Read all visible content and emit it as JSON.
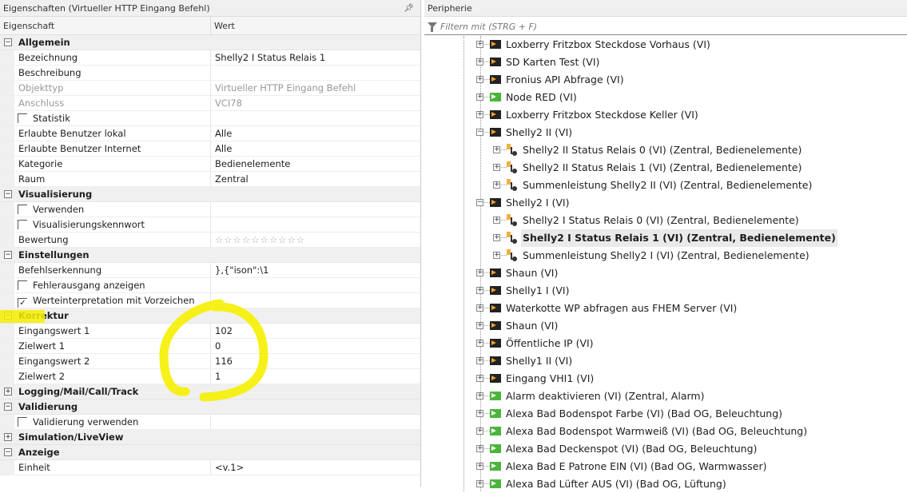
{
  "left_panel": {
    "title": "Eigenschaften (Virtueller HTTP Eingang Befehl)",
    "pin_icon": "pin-icon",
    "columns": [
      "Eigenschaft",
      "Wert"
    ],
    "rating_stars": 10,
    "sections": [
      {
        "label": "Allgemein",
        "expanded": true,
        "rows": [
          {
            "key": "Bezeichnung",
            "value": "Shelly2 I Status Relais 1"
          },
          {
            "key": "Beschreibung",
            "value": ""
          },
          {
            "key": "Objekttyp",
            "value": "Virtueller HTTP Eingang Befehl",
            "disabled": true
          },
          {
            "key": "Anschluss",
            "value": "VCI78",
            "disabled": true
          },
          {
            "key": "Statistik",
            "value": "",
            "checkbox": true,
            "checked": false
          },
          {
            "key": "Erlaubte Benutzer lokal",
            "value": "Alle"
          },
          {
            "key": "Erlaubte Benutzer Internet",
            "value": "Alle"
          },
          {
            "key": "Kategorie",
            "value": "Bedienelemente"
          },
          {
            "key": "Raum",
            "value": "Zentral"
          }
        ]
      },
      {
        "label": "Visualisierung",
        "expanded": true,
        "rows": [
          {
            "key": "Verwenden",
            "value": "",
            "checkbox": true,
            "checked": false
          },
          {
            "key": "Visualisierungskennwort",
            "value": "",
            "checkbox": true,
            "checked": false
          },
          {
            "key": "Bewertung",
            "value": "☆☆☆☆☆☆☆☆☆☆"
          }
        ]
      },
      {
        "label": "Einstellungen",
        "expanded": true,
        "rows": [
          {
            "key": "Befehlserkennung",
            "value": "},{\"ison\":\\1"
          },
          {
            "key": "Fehlerausgang anzeigen",
            "value": "",
            "checkbox": true,
            "checked": false
          },
          {
            "key": "Werteinterpretation mit Vorzeichen",
            "value": "",
            "checkbox": true,
            "checked": true
          }
        ]
      },
      {
        "label": "Korrektur",
        "expanded": true,
        "highlighted": true,
        "rows": [
          {
            "key": "Eingangswert 1",
            "value": "102"
          },
          {
            "key": "Zielwert 1",
            "value": "0"
          },
          {
            "key": "Eingangswert 2",
            "value": "116"
          },
          {
            "key": "Zielwert 2",
            "value": "1"
          }
        ]
      },
      {
        "label": "Logging/Mail/Call/Track",
        "expanded": false,
        "rows": []
      },
      {
        "label": "Validierung",
        "expanded": true,
        "rows": [
          {
            "key": "Validierung verwenden",
            "value": "",
            "checkbox": true,
            "checked": false
          }
        ]
      },
      {
        "label": "Simulation/LiveView",
        "expanded": false,
        "rows": []
      },
      {
        "label": "Anzeige",
        "expanded": true,
        "rows": [
          {
            "key": "Einheit",
            "value": "<v.1>"
          }
        ]
      }
    ]
  },
  "right_panel": {
    "title": "Peripherie",
    "filter_placeholder": "Filtern mit (STRG + F)",
    "tree": [
      {
        "label": "Loxberry Fritzbox Steckdose Vorhaus (VI)",
        "level": 0,
        "icon": "virtual-input-icon",
        "expanded": false
      },
      {
        "label": "SD Karten Test (VI)",
        "level": 0,
        "icon": "virtual-input-icon",
        "expanded": false
      },
      {
        "label": "Fronius API Abfrage (VI)",
        "level": 0,
        "icon": "virtual-input-icon",
        "expanded": false
      },
      {
        "label": "Node RED (VI)",
        "level": 0,
        "icon": "virtual-input-green-icon",
        "expanded": false
      },
      {
        "label": "Loxberry Fritzbox Steckdose Keller (VI)",
        "level": 0,
        "icon": "virtual-input-icon",
        "expanded": false
      },
      {
        "label": "Shelly2 II (VI)",
        "level": 0,
        "icon": "virtual-input-icon",
        "expanded": true
      },
      {
        "label": "Shelly2  II Status Relais 0 (VI) (Zentral, Bedienelemente)",
        "level": 1,
        "icon": "command-icon",
        "expanded": false
      },
      {
        "label": "Shelly2 II Status Relais 1 (VI) (Zentral, Bedienelemente)",
        "level": 1,
        "icon": "command-icon",
        "expanded": false
      },
      {
        "label": "Summenleistung Shelly2 II (VI) (Zentral, Bedienelemente)",
        "level": 1,
        "icon": "command-icon",
        "expanded": false
      },
      {
        "label": "Shelly2 I (VI)",
        "level": 0,
        "icon": "virtual-input-icon",
        "expanded": true
      },
      {
        "label": "Shelly2 I Status Relais 0 (VI) (Zentral, Bedienelemente)",
        "level": 1,
        "icon": "command-icon",
        "expanded": false
      },
      {
        "label": "Shelly2 I Status Relais 1 (VI) (Zentral, Bedienelemente)",
        "level": 1,
        "icon": "command-icon",
        "expanded": false,
        "selected": true
      },
      {
        "label": "Summenleistung Shelly2 I (VI) (Zentral, Bedienelemente)",
        "level": 1,
        "icon": "command-icon",
        "expanded": false
      },
      {
        "label": "Shaun (VI)",
        "level": 0,
        "icon": "virtual-input-icon",
        "expanded": false
      },
      {
        "label": "Shelly1 I (VI)",
        "level": 0,
        "icon": "virtual-input-icon",
        "expanded": false
      },
      {
        "label": "Waterkotte WP abfragen aus FHEM Server (VI)",
        "level": 0,
        "icon": "virtual-input-icon",
        "expanded": false
      },
      {
        "label": "Shaun (VI)",
        "level": 0,
        "icon": "virtual-input-icon",
        "expanded": false
      },
      {
        "label": "Öffentliche IP (VI)",
        "level": 0,
        "icon": "virtual-input-icon",
        "expanded": false
      },
      {
        "label": "Shelly1 II (VI)",
        "level": 0,
        "icon": "virtual-input-icon",
        "expanded": false
      },
      {
        "label": "Eingang VHI1 (VI)",
        "level": 0,
        "icon": "virtual-input-icon",
        "expanded": false
      },
      {
        "label": "Alarm deaktivieren (VI) (Zentral, Alarm)",
        "level": 0,
        "icon": "virtual-input-green-icon",
        "expanded": false
      },
      {
        "label": "Alexa Bad Bodenspot Farbe (VI) (Bad OG, Beleuchtung)",
        "level": 0,
        "icon": "virtual-input-green-icon",
        "expanded": false
      },
      {
        "label": "Alexa Bad Bodenspot Warmweiß (VI) (Bad OG, Beleuchtung)",
        "level": 0,
        "icon": "virtual-input-green-icon",
        "expanded": false
      },
      {
        "label": "Alexa Bad Deckenspot (VI) (Bad OG, Beleuchtung)",
        "level": 0,
        "icon": "virtual-input-green-icon",
        "expanded": false
      },
      {
        "label": "Alexa Bad E Patrone EIN (VI) (Bad OG, Warmwasser)",
        "level": 0,
        "icon": "virtual-input-green-icon",
        "expanded": false
      },
      {
        "label": "Alexa Bad Lüfter AUS (VI) (Bad OG, Lüftung)",
        "level": 0,
        "icon": "virtual-input-green-icon",
        "expanded": false
      }
    ]
  },
  "colors": {
    "annotation": "#f5f000",
    "selected_bg": "#eaeaea",
    "category_bg": "#f0f0f0",
    "green_icon": "#4cb43c",
    "orange_arrow": "#f0a030"
  }
}
